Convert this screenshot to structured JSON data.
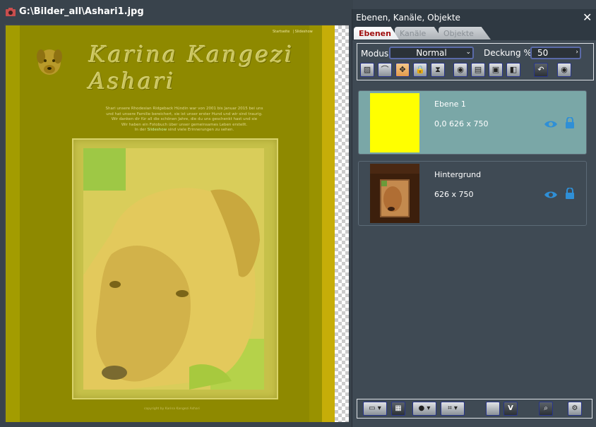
{
  "image_window": {
    "title": "G:\\Bilder_all\\Ashari1.jpg",
    "title_icon": "camera-icon",
    "document": {
      "top_links": [
        "Startseite",
        "Slideshow"
      ],
      "site_title": "Karina Kangezi Ashari",
      "intro_lines": [
        "Shari unsere Rhodesian Ridgeback Hündin war von 2001 bis Januar 2015 bei uns",
        "und hat unsere Familie bereichert, sie ist unser erster Hund und wir sind traurig.",
        "Wir danken dir für all die schönen Jahre, die du uns geschenkt hast und sie",
        "Wir haben ein Fotobuch über unser gemeinsames Leben erstellt."
      ],
      "intro_last_prefix": "In der",
      "intro_link": "Slideshow",
      "intro_last_suffix": "sind viele Erinnerungen zu sehen.",
      "footer": "copyright by Karina Kangezi Ashari"
    }
  },
  "panel": {
    "title": "Ebenen, Kanäle, Objekte",
    "close_label": "✕",
    "tabs": [
      "Ebenen",
      "Kanäle",
      "Objekte"
    ],
    "active_tab": "Ebenen",
    "mode_label": "Modus",
    "mode_value": "Normal",
    "opacity_label": "Deckung %",
    "opacity_value": "50",
    "tools": [
      "hatch-icon",
      "curve-icon",
      "move-icon",
      "lock-icon",
      "hourglass-icon",
      "eye-icon",
      "layer-icon",
      "merge-icon",
      "mask-icon",
      "undo-icon",
      "eye-dark-icon"
    ],
    "layers": [
      {
        "name": "Ebene 1",
        "info": "0,0  626 x 750",
        "active": true,
        "thumb_color": "#ffff00"
      },
      {
        "name": "Hintergrund",
        "info": "626 x 750",
        "active": false
      }
    ],
    "bottom_tools": [
      "new-layer-icon",
      "dotted-icon",
      "circle-icon",
      "fx-icon",
      "gradient-icon",
      "v-icon",
      "search-icon",
      "settings-icon"
    ],
    "bottom_v_label": "V"
  },
  "colors": {
    "accent": "#2f8fd6",
    "active_layer": "#7aa7a7",
    "tab_active_text": "#a01010"
  }
}
